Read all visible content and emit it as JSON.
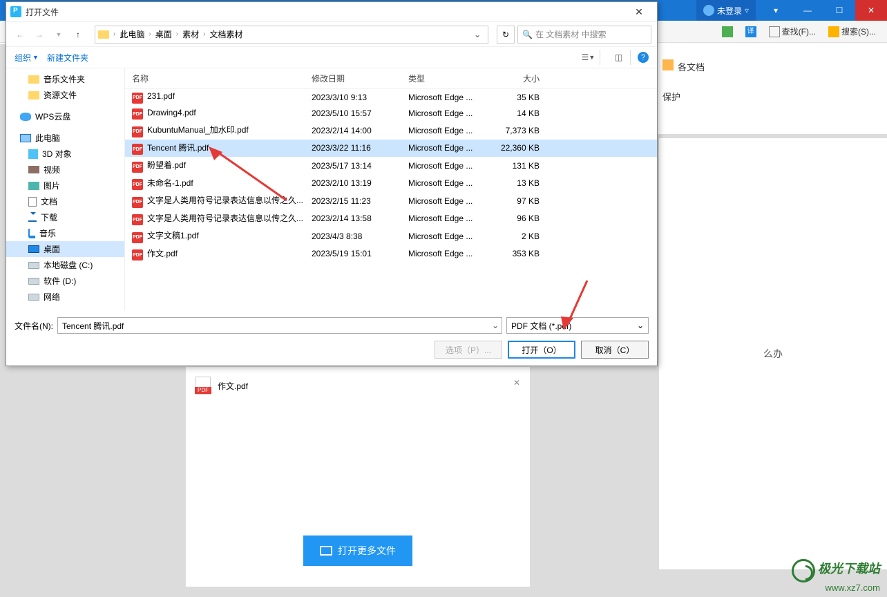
{
  "bgApp": {
    "login": "未登录",
    "toolbar": {
      "find": "查找(F)...",
      "search": "搜索(S)..."
    },
    "rightPanel": {
      "line1": "各文档",
      "line2": "保护"
    },
    "mainRightText": "么办",
    "centerDoc": "作文.pdf",
    "openMore": "打开更多文件"
  },
  "dialog": {
    "title": "打开文件",
    "breadcrumb": [
      "此电脑",
      "桌面",
      "素材",
      "文档素材"
    ],
    "searchPlaceholder": "在 文档素材 中搜索",
    "organize": "组织",
    "newFolder": "新建文件夹",
    "tree": [
      {
        "label": "音乐文件夹",
        "icon": "folder",
        "indent": true
      },
      {
        "label": "资源文件",
        "icon": "folder",
        "indent": true
      },
      {
        "label": "WPS云盘",
        "icon": "cloud",
        "top": true
      },
      {
        "label": "此电脑",
        "icon": "pc",
        "top": true
      },
      {
        "label": "3D 对象",
        "icon": "3d"
      },
      {
        "label": "视频",
        "icon": "video"
      },
      {
        "label": "图片",
        "icon": "img"
      },
      {
        "label": "文档",
        "icon": "doc"
      },
      {
        "label": "下载",
        "icon": "dl"
      },
      {
        "label": "音乐",
        "icon": "music"
      },
      {
        "label": "桌面",
        "icon": "desktop",
        "selected": true
      },
      {
        "label": "本地磁盘 (C:)",
        "icon": "disk"
      },
      {
        "label": "软件 (D:)",
        "icon": "disk"
      },
      {
        "label": "网络",
        "icon": "disk"
      }
    ],
    "columns": {
      "name": "名称",
      "date": "修改日期",
      "type": "类型",
      "size": "大小"
    },
    "files": [
      {
        "name": "231.pdf",
        "date": "2023/3/10 9:13",
        "type": "Microsoft Edge ...",
        "size": "35 KB"
      },
      {
        "name": "Drawing4.pdf",
        "date": "2023/5/10 15:57",
        "type": "Microsoft Edge ...",
        "size": "14 KB"
      },
      {
        "name": "KubuntuManual_加水印.pdf",
        "date": "2023/2/14 14:00",
        "type": "Microsoft Edge ...",
        "size": "7,373 KB"
      },
      {
        "name": "Tencent 腾讯.pdf",
        "date": "2023/3/22 11:16",
        "type": "Microsoft Edge ...",
        "size": "22,360 KB",
        "selected": true
      },
      {
        "name": "盼望着.pdf",
        "date": "2023/5/17 13:14",
        "type": "Microsoft Edge ...",
        "size": "131 KB"
      },
      {
        "name": "未命名-1.pdf",
        "date": "2023/2/10 13:19",
        "type": "Microsoft Edge ...",
        "size": "13 KB"
      },
      {
        "name": "文字是人类用符号记录表达信息以传之久...",
        "date": "2023/2/15 11:23",
        "type": "Microsoft Edge ...",
        "size": "97 KB"
      },
      {
        "name": "文字是人类用符号记录表达信息以传之久...",
        "date": "2023/2/14 13:58",
        "type": "Microsoft Edge ...",
        "size": "96 KB"
      },
      {
        "name": "文字文稿1.pdf",
        "date": "2023/4/3 8:38",
        "type": "Microsoft Edge ...",
        "size": "2 KB"
      },
      {
        "name": "作文.pdf",
        "date": "2023/5/19 15:01",
        "type": "Microsoft Edge ...",
        "size": "353 KB"
      }
    ],
    "filenameLabel": "文件名(N):",
    "filenameValue": "Tencent 腾讯.pdf",
    "filter": "PDF 文档 (*.pdf)",
    "optionsBtn": "选项（P）...",
    "openBtn": "打开（O）",
    "cancelBtn": "取消（C）"
  },
  "watermark": {
    "brand": "极光下载站",
    "url": "www.xz7.com"
  }
}
